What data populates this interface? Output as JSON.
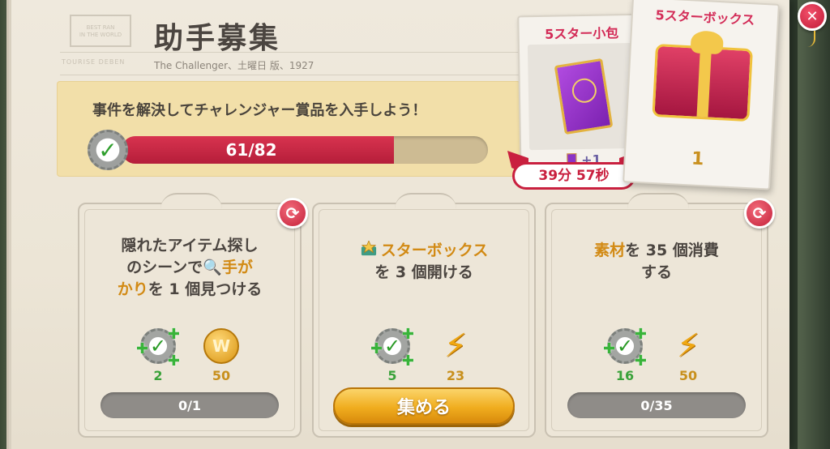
{
  "header": {
    "title": "助手募集",
    "subtitle": "The Challenger、土曜日 版、1927",
    "stamp_line1": "BEST RAN",
    "stamp_line2": "IN THE WORLD",
    "stamp_line3": "TOURISE DEBEN"
  },
  "goal": {
    "text": "事件を解決してチャレンジャー賞品を入手しよう！",
    "progress_label": "61/82",
    "progress_current": 61,
    "progress_total": 82
  },
  "prizes": {
    "pack": {
      "title": "5スター小包",
      "count_label": "+1",
      "timer": "39分 57秒"
    },
    "box": {
      "title": "5スターボックス",
      "count_label": "1"
    }
  },
  "tasks": [
    {
      "text_a": "隠れたアイテム探し",
      "text_b": "のシーンで",
      "highlight_1": "手が",
      "highlight_2": "かり",
      "text_c": "を 1 個見つける",
      "reward_xp": "2",
      "reward_other": "50",
      "reward_other_icon": "coin-icon",
      "status_label": "0/1"
    },
    {
      "highlight": "スターボックス",
      "text": "を 3 個開ける",
      "reward_xp": "5",
      "reward_other": "23",
      "reward_other_icon": "energy-bolt-icon",
      "button_label": "集める"
    },
    {
      "highlight": "素材",
      "text_a": "を 35 個消費",
      "text_b": "する",
      "reward_xp": "16",
      "reward_other": "50",
      "reward_other_icon": "energy-bolt-icon",
      "status_label": "0/35"
    }
  ],
  "colors": {
    "progress": "#c8223f",
    "accent_gold": "#d28a14",
    "prize_title": "#d32b57",
    "xp_green": "#3aa23a"
  }
}
